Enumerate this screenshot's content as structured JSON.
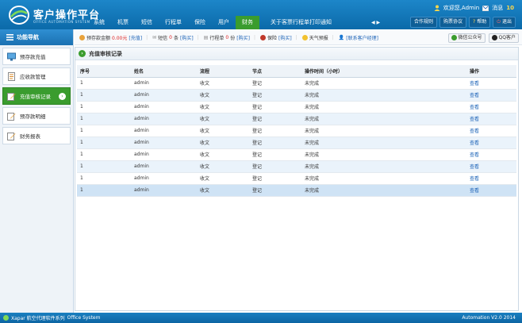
{
  "header": {
    "title": "客户操作平台",
    "subtitle": "OFFICE AUTOMATION SYSTEM",
    "welcome": "欢迎您,Admin",
    "messages_label": "消息",
    "messages_count": "10",
    "nav": [
      "系统",
      "机票",
      "短信",
      "行程单",
      "保险",
      "用户",
      "财务"
    ],
    "active_nav": "财务",
    "notice": "关于客票行程单打印通知",
    "notice_arrows": "◀ ▶",
    "buttons": {
      "partner_rules": "合作规则",
      "purchase_agreement": "购票协议",
      "help": "帮助",
      "logout": "退出"
    }
  },
  "sidebar": {
    "title": "功能导航",
    "items": [
      {
        "label": "预存款充值",
        "icon": "monitor-icon"
      },
      {
        "label": "应收款管理",
        "icon": "document-icon"
      },
      {
        "label": "充值审核记录",
        "icon": "edit-icon",
        "active": true
      },
      {
        "label": "预存款明细",
        "icon": "edit-icon"
      },
      {
        "label": "财务报表",
        "icon": "edit-icon"
      }
    ]
  },
  "infobar": {
    "balance_label": "预存款金额",
    "balance_value": "0.00元",
    "balance_link": "[充值]",
    "sms_label": "短信",
    "sms_count": "0",
    "sms_unit": "条",
    "sms_link": "[购买]",
    "itinerary_label": "行程单",
    "itinerary_count": "0",
    "itinerary_unit": "份",
    "itinerary_link": "[购买]",
    "insurance_label": "保险",
    "insurance_link": "[购买]",
    "weather_label": "天气预报",
    "contact_link": "[联系客户经理]",
    "wechat": "微信公众号",
    "qq": "QQ客户"
  },
  "panel": {
    "title": "充值审核记录",
    "columns": [
      "序号",
      "姓名",
      "流程",
      "节点",
      "操作时间（小时）",
      "操作"
    ],
    "rows": [
      [
        "1",
        "admin",
        "收文",
        "登记",
        "未完成",
        "查看"
      ],
      [
        "1",
        "admin",
        "收文",
        "登记",
        "未完成",
        "查看"
      ],
      [
        "1",
        "admin",
        "收文",
        "登记",
        "未完成",
        "查看"
      ],
      [
        "1",
        "admin",
        "收文",
        "登记",
        "未完成",
        "查看"
      ],
      [
        "1",
        "admin",
        "收文",
        "登记",
        "未完成",
        "查看"
      ],
      [
        "1",
        "admin",
        "收文",
        "登记",
        "未完成",
        "查看"
      ],
      [
        "1",
        "admin",
        "收文",
        "登记",
        "未完成",
        "查看"
      ],
      [
        "1",
        "admin",
        "收文",
        "登记",
        "未完成",
        "查看"
      ],
      [
        "1",
        "admin",
        "收文",
        "登记",
        "未完成",
        "查看"
      ],
      [
        "1",
        "admin",
        "收文",
        "登记",
        "未完成",
        "查看"
      ]
    ]
  },
  "footer": {
    "company": "Xapar 航空代理软件系列",
    "product": "Office System",
    "version": "Automation  V2.0 2014"
  },
  "colors": {
    "header_blue": "#0b6aa9",
    "active_green": "#3a9c2e",
    "link_blue": "#1c63b7",
    "alert_red": "#d22222"
  }
}
